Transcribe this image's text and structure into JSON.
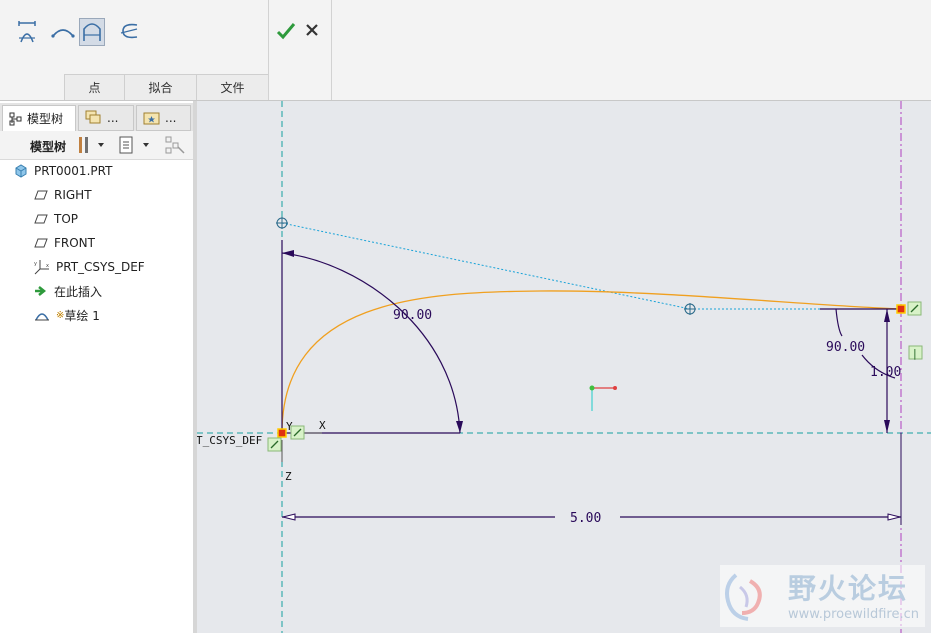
{
  "ribbon": {
    "tabs": [
      "点",
      "拟合",
      "文件"
    ],
    "tools": [
      "dimension-tool-icon",
      "curve-tool-icon",
      "arc-tool-icon",
      "spline-tool-icon"
    ],
    "confirm_icon": "checkmark-icon",
    "cancel_icon": "close-icon"
  },
  "panel": {
    "tabs": [
      {
        "label": "模型树",
        "icon": "model-tree-icon"
      },
      {
        "label": "...",
        "icon": "layers-icon"
      },
      {
        "label": "...",
        "icon": "favorites-icon"
      }
    ],
    "toolbar_label": "模型树",
    "tree": [
      {
        "label": "PRT0001.PRT",
        "icon": "part-icon"
      },
      {
        "label": "RIGHT",
        "icon": "datum-plane-icon"
      },
      {
        "label": "TOP",
        "icon": "datum-plane-icon"
      },
      {
        "label": "FRONT",
        "icon": "datum-plane-icon"
      },
      {
        "label": "PRT_CSYS_DEF",
        "icon": "csys-icon"
      },
      {
        "label": "在此插入",
        "icon": "insert-arrow-icon"
      },
      {
        "label": "草绘 1",
        "icon": "sketch-icon",
        "prefix": "※"
      }
    ]
  },
  "sketch": {
    "dim_angle_left": "90.00",
    "dim_angle_right": "90.00",
    "dim_vertical": "1.00",
    "dim_horizontal": "5.00",
    "csys_label": "T_CSYS_DEF",
    "axis_x": "X",
    "axis_y": "Y",
    "axis_z": "Z",
    "vertical_constraint": "|",
    "colors": {
      "curve": "#f0a020",
      "dimension": "#2a0a5a",
      "centerline": "#17a0a0",
      "tangent": "#1aa3d8",
      "reference": "#b040c0"
    }
  },
  "watermark": {
    "brand": "野火论坛",
    "url": "www.proewildfire.cn"
  }
}
